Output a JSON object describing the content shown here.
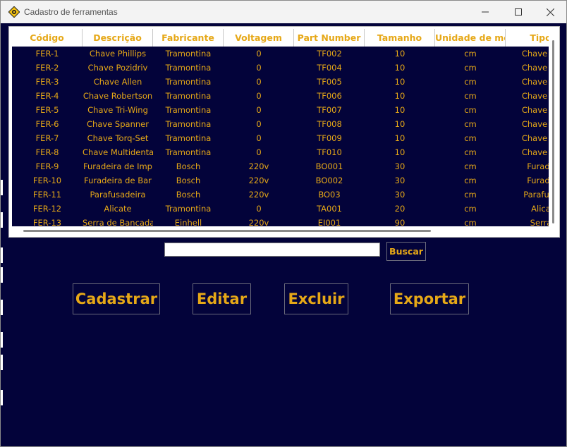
{
  "window": {
    "title": "Cadastro de ferramentas"
  },
  "table": {
    "columns": [
      "Código",
      "Descrição",
      "Fabricante",
      "Voltagem",
      "Part Number",
      "Tamanho",
      "Unidade de me",
      "Tipo"
    ],
    "rows": [
      [
        "FER-1",
        "Chave Phillips",
        "Tramontina",
        "0",
        "TF002",
        "10",
        "cm",
        "Chave de"
      ],
      [
        "FER-2",
        "Chave Pozidriv",
        "Tramontina",
        "0",
        "TF004",
        "10",
        "cm",
        "Chave de"
      ],
      [
        "FER-3",
        "Chave Allen",
        "Tramontina",
        "0",
        "TF005",
        "10",
        "cm",
        "Chave de"
      ],
      [
        "FER-4",
        "Chave Robertson",
        "Tramontina",
        "0",
        "TF006",
        "10",
        "cm",
        "Chave de"
      ],
      [
        "FER-5",
        "Chave Tri-Wing",
        "Tramontina",
        "0",
        "TF007",
        "10",
        "cm",
        "Chave de"
      ],
      [
        "FER-6",
        "Chave Spanner",
        "Tramontina",
        "0",
        "TF008",
        "10",
        "cm",
        "Chave de"
      ],
      [
        "FER-7",
        "Chave Torq-Set",
        "Tramontina",
        "0",
        "TF009",
        "10",
        "cm",
        "Chave de"
      ],
      [
        "FER-8",
        "Chave Multidenta",
        "Tramontina",
        "0",
        "TF010",
        "10",
        "cm",
        "Chave de"
      ],
      [
        "FER-9",
        "Furadeira de Imp",
        "Bosch",
        "220v",
        "BO001",
        "30",
        "cm",
        "Furade"
      ],
      [
        "FER-10",
        "Furadeira de Bar",
        "Bosch",
        "220v",
        "BO002",
        "30",
        "cm",
        "Furade"
      ],
      [
        "FER-11",
        "Parafusadeira",
        "Bosch",
        "220v",
        "BO03",
        "30",
        "cm",
        "Parafusa"
      ],
      [
        "FER-12",
        "Alicate",
        "Tramontina",
        "0",
        "TA001",
        "20",
        "cm",
        "Alica"
      ],
      [
        "FER-13",
        "Serra de Bancada",
        "Einhell",
        "220v",
        "EI001",
        "90",
        "cm",
        "Serra"
      ]
    ]
  },
  "search": {
    "value": "",
    "button_label": "Buscar"
  },
  "actions": {
    "register_label": "Cadastrar",
    "edit_label": "Editar",
    "delete_label": "Excluir",
    "export_label": "Exportar"
  },
  "colors": {
    "background": "#03033a",
    "accent": "#e6a817"
  }
}
